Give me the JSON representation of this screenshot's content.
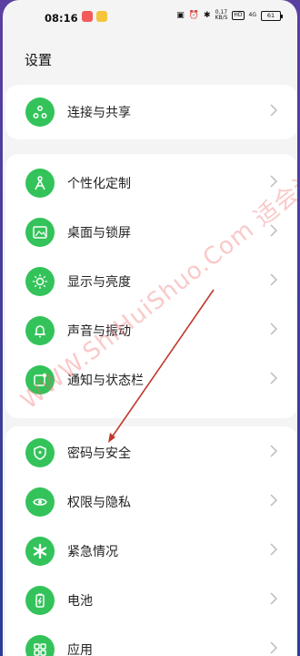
{
  "status_bar": {
    "time": "08:16",
    "net_speed_value": "0.17",
    "net_speed_unit": "KB/S",
    "signal": "4G",
    "hd": "HD",
    "battery": "61"
  },
  "page": {
    "title": "设置"
  },
  "group1": [
    {
      "label": "连接与共享",
      "icon": "connection-share-icon"
    }
  ],
  "group2": [
    {
      "label": "个性化定制",
      "icon": "personalization-icon"
    },
    {
      "label": "桌面与锁屏",
      "icon": "wallpaper-icon"
    },
    {
      "label": "显示与亮度",
      "icon": "brightness-icon"
    },
    {
      "label": "声音与振动",
      "icon": "sound-vibration-icon"
    },
    {
      "label": "通知与状态栏",
      "icon": "notification-icon"
    }
  ],
  "group3": [
    {
      "label": "密码与安全",
      "icon": "security-icon"
    },
    {
      "label": "权限与隐私",
      "icon": "privacy-icon"
    },
    {
      "label": "紧急情况",
      "icon": "emergency-icon"
    },
    {
      "label": "电池",
      "icon": "battery-icon"
    },
    {
      "label": "应用",
      "icon": "apps-icon"
    }
  ],
  "watermark": "WWW.ShiHuiShuo.Com 适会说",
  "colors": {
    "icon_green": "#33c35a",
    "annotation_arrow": "#c0392b",
    "watermark": "#f06464"
  }
}
